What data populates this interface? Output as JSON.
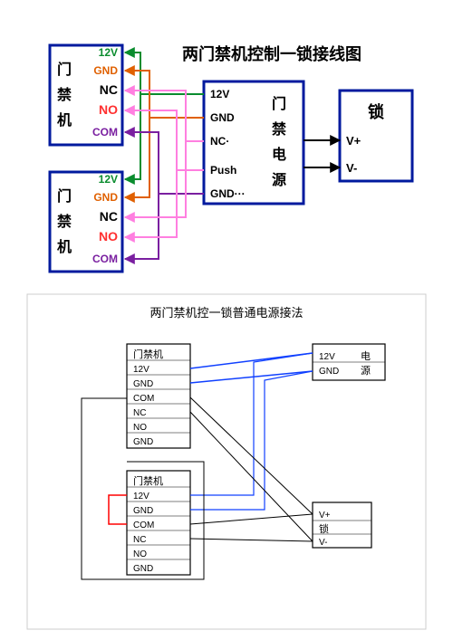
{
  "top": {
    "title": "两门禁机控制一锁接线图",
    "left_box_label": "门禁机",
    "center_box_label": "门禁电源",
    "right_box_label": "锁",
    "left_pins": [
      "12V",
      "GND",
      "NC",
      "NO",
      "COM"
    ],
    "center_pins": [
      "12V",
      "GND",
      "NC·",
      "Push",
      "GND···"
    ],
    "right_pins": [
      "V+",
      "V-"
    ],
    "colors": {
      "12v": "#0a8c2e",
      "gnd": "#e06000",
      "nc": "#000000",
      "no": "#ff3030",
      "com": "#7a1fa0",
      "push": "#ff7fe0",
      "border": "#001a9e",
      "arrow": "#000000"
    }
  },
  "bottom": {
    "title": "两门禁机控一锁普通电源接法",
    "left_box_label": "门禁机",
    "left_pins": [
      "12V",
      "GND",
      "COM",
      "NC",
      "NO",
      "GND"
    ],
    "right_top_label": "电源",
    "right_top_pins": [
      "12V",
      "GND"
    ],
    "right_bottom_label": "锁",
    "right_bottom_pins": [
      "V+",
      "V-"
    ]
  }
}
